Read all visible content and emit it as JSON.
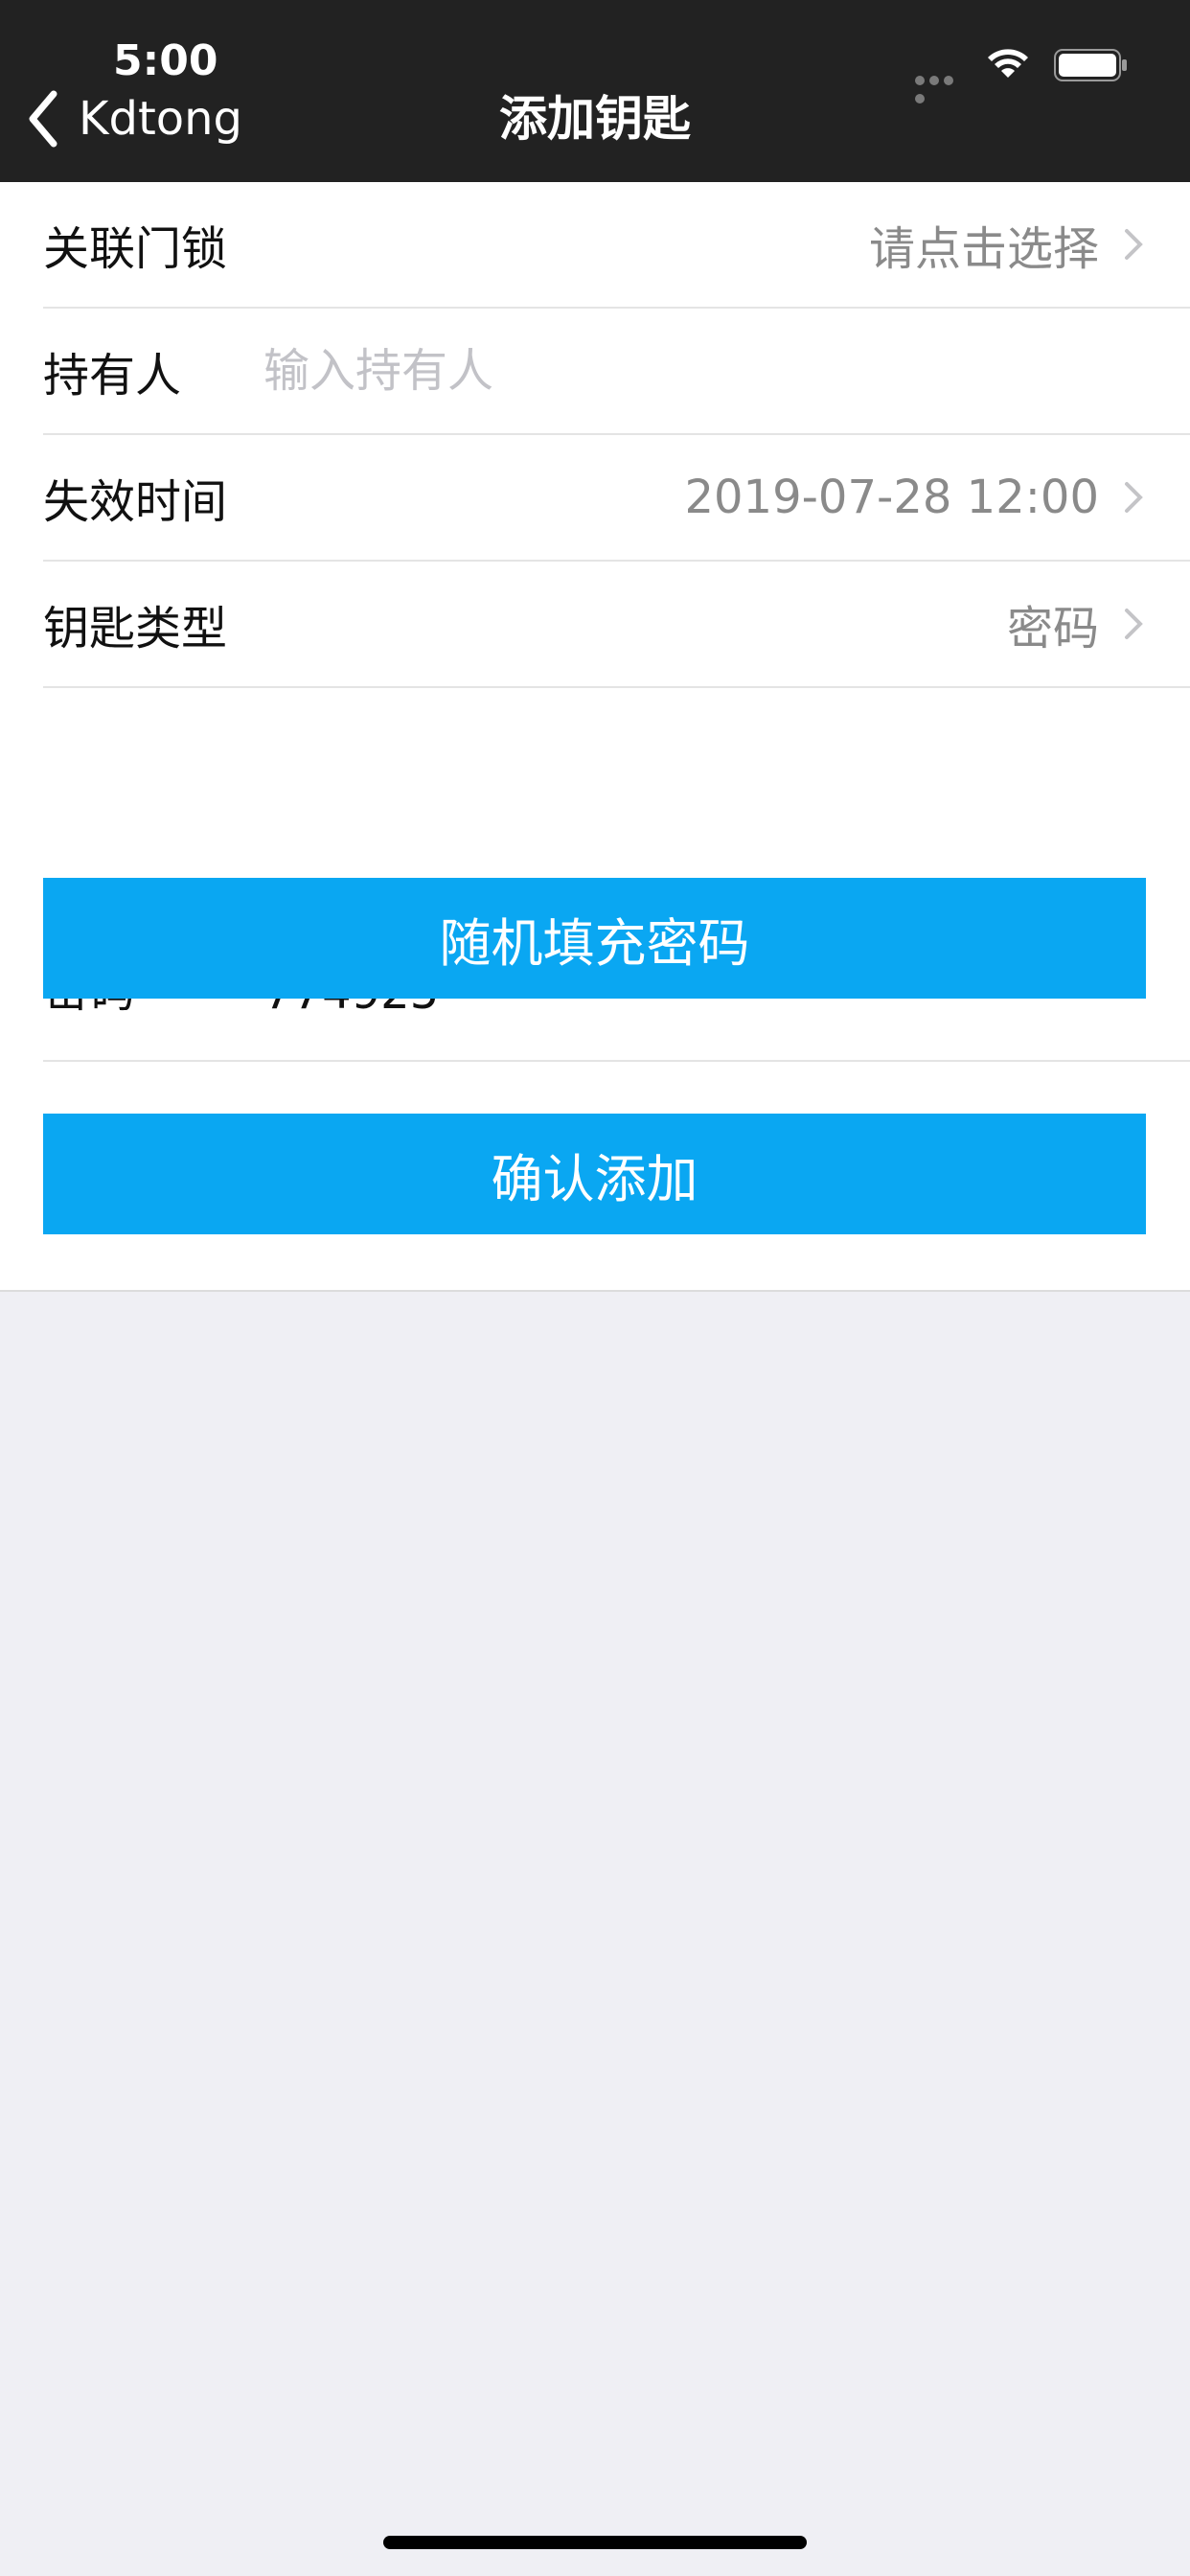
{
  "status_bar": {
    "time": "5:00"
  },
  "nav": {
    "back_label": "Kdtong",
    "title": "添加钥匙"
  },
  "form": {
    "lock": {
      "label": "关联门锁",
      "value": "请点击选择"
    },
    "holder": {
      "label": "持有人",
      "placeholder": "输入持有人",
      "value": ""
    },
    "expiry": {
      "label": "失效时间",
      "value": "2019-07-28 12:00"
    },
    "key_type": {
      "label": "钥匙类型",
      "value": "密码"
    },
    "password": {
      "label": "密码",
      "value": "774925"
    }
  },
  "buttons": {
    "random_fill": "随机填充密码",
    "confirm": "确认添加"
  },
  "colors": {
    "accent": "#0aa7f2",
    "header_bg": "#222222",
    "page_bg": "#efeff4"
  }
}
